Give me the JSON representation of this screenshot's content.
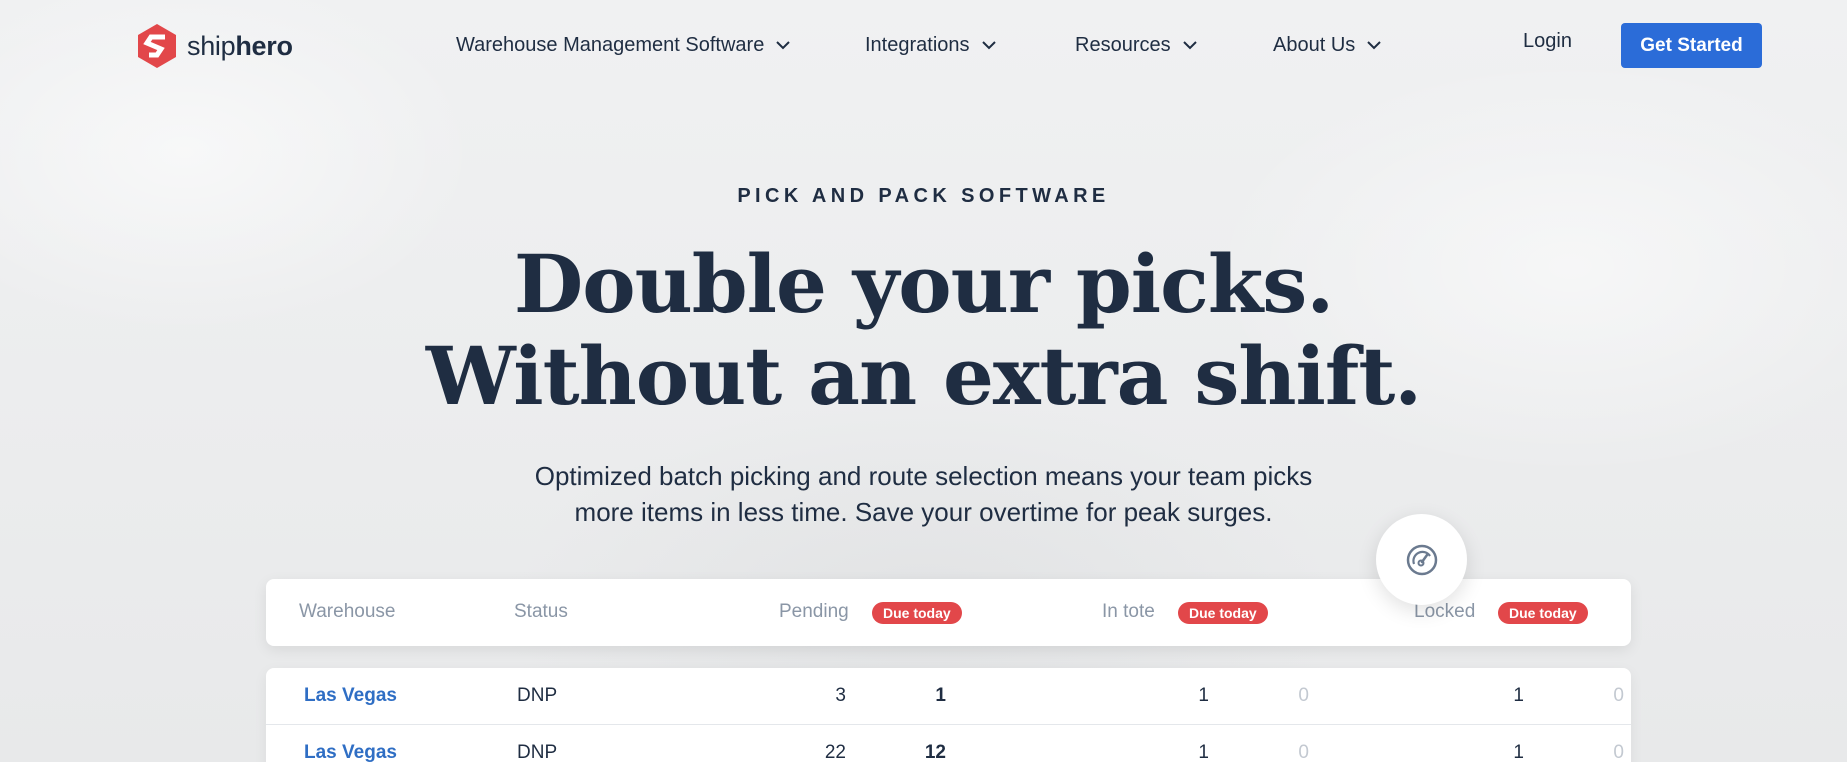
{
  "brand": {
    "name_light": "ship",
    "name_bold": "hero",
    "logo_color": "#e2474a"
  },
  "nav": {
    "menus": [
      {
        "label": "Warehouse Management Software",
        "icon": "chevron-down-icon"
      },
      {
        "label": "Integrations",
        "icon": "chevron-down-icon"
      },
      {
        "label": "Resources",
        "icon": "chevron-down-icon"
      },
      {
        "label": "About Us",
        "icon": "chevron-down-icon"
      }
    ],
    "login": "Login",
    "cta": "Get Started"
  },
  "hero": {
    "eyebrow": "PICK AND PACK SOFTWARE",
    "headline_line1": "Double your picks.",
    "headline_line2": "Without an extra shift.",
    "subcopy_line1": "Optimized batch picking and route selection means your team picks",
    "subcopy_line2": "more items in less time. Save your overtime for peak surges."
  },
  "table": {
    "headers": {
      "warehouse": "Warehouse",
      "status": "Status",
      "pending": "Pending",
      "in_tote": "In tote",
      "locked": "Locked",
      "badge": "Due today"
    },
    "rows": [
      {
        "warehouse": "Las Vegas",
        "status": "DNP",
        "pending": "3",
        "pending_due": "1",
        "in_tote": "1",
        "in_tote_due": "0",
        "locked": "1",
        "locked_due": "0"
      },
      {
        "warehouse": "Las Vegas",
        "status": "DNP",
        "pending": "22",
        "pending_due": "12",
        "in_tote": "1",
        "in_tote_due": "0",
        "locked": "1",
        "locked_due": "0"
      }
    ]
  },
  "fab": {
    "icon": "speedometer-icon"
  },
  "colors": {
    "primary": "#2b6cd8",
    "text": "#1f2d42",
    "badge": "#e2474a",
    "link": "#2f6ec4"
  }
}
